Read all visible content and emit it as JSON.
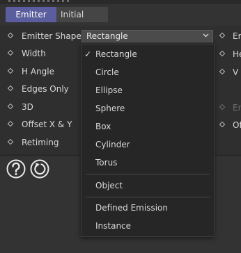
{
  "tabs": {
    "active": "Emitter",
    "inactive": "Initial State"
  },
  "left_params": [
    {
      "label": "Emitter Shape"
    },
    {
      "label": "Width"
    },
    {
      "label": "H Angle"
    },
    {
      "label": "Edges Only"
    },
    {
      "label": "3D"
    },
    {
      "label": "Offset X & Y"
    },
    {
      "label": "Retiming"
    }
  ],
  "right_params": [
    {
      "label": "Em",
      "dim": false
    },
    {
      "label": "He",
      "dim": false
    },
    {
      "label": "V A",
      "dim": false
    },
    {
      "label": "En",
      "dim": true
    },
    {
      "label": "Of",
      "dim": false
    }
  ],
  "emitter_shape_select": {
    "value": "Rectangle"
  },
  "dropdown": {
    "selected": "Rectangle",
    "groups": [
      [
        "Rectangle",
        "Circle",
        "Ellipse",
        "Sphere",
        "Box",
        "Cylinder",
        "Torus"
      ],
      [
        "Object"
      ],
      [
        "Defined Emission",
        "Instance"
      ]
    ]
  },
  "footer_icons": [
    "help-icon",
    "reset-icon"
  ]
}
